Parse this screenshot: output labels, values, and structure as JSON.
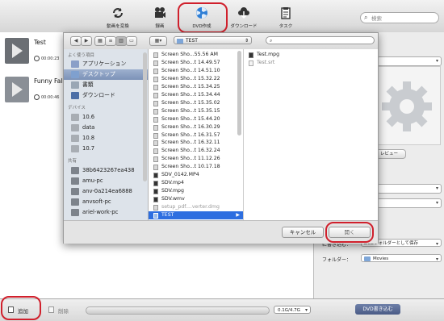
{
  "toolbar": {
    "buttons": [
      {
        "label": "動画を変換",
        "icon": "convert-icon"
      },
      {
        "label": "録画",
        "icon": "record-icon"
      },
      {
        "label": "DVD作成",
        "icon": "dvd-burn-icon"
      },
      {
        "label": "ダウンロード",
        "icon": "download-icon"
      },
      {
        "label": "タスク",
        "icon": "task-icon"
      }
    ],
    "search_placeholder": "検索"
  },
  "videos": [
    {
      "title": "Test",
      "duration": "00:00:23"
    },
    {
      "title": "Funny Fall",
      "duration": "00:00:46"
    }
  ],
  "right_panel": {
    "preview_label": "レビュー",
    "write_label": "に書き込む：",
    "write_value": "DVDフォルダーとして保存",
    "folder_label": "フォルダー：",
    "folder_value": "Movies"
  },
  "bottom": {
    "add_label": "追加",
    "delete_label": "削除",
    "capacity": "0.1G/4.7G",
    "burn_label": "DVD書き込む"
  },
  "dialog": {
    "location": "TEST",
    "search_icon": "search-icon",
    "sidebar": [
      {
        "kind": "head",
        "label": "よく使う項目"
      },
      {
        "kind": "item",
        "label": "アプリケーション",
        "icon": "applications-icon"
      },
      {
        "kind": "item",
        "label": "デスクトップ",
        "icon": "desktop-icon",
        "selected": true
      },
      {
        "kind": "item",
        "label": "書類",
        "icon": "documents-icon"
      },
      {
        "kind": "item",
        "label": "ダウンロード",
        "icon": "downloads-icon"
      },
      {
        "kind": "head",
        "label": "デバイス"
      },
      {
        "kind": "item",
        "label": "10.6",
        "icon": "disk-icon"
      },
      {
        "kind": "item",
        "label": "data",
        "icon": "disk-icon"
      },
      {
        "kind": "item",
        "label": "10.8",
        "icon": "disk-icon"
      },
      {
        "kind": "item",
        "label": "10.7",
        "icon": "disk-icon"
      },
      {
        "kind": "head",
        "label": "共有"
      },
      {
        "kind": "item",
        "label": "38b6423267ea438",
        "icon": "network-computer-icon"
      },
      {
        "kind": "item",
        "label": "amu-pc",
        "icon": "network-computer-icon"
      },
      {
        "kind": "item",
        "label": "anv-0a214ea6888",
        "icon": "network-computer-icon"
      },
      {
        "kind": "item",
        "label": "anvsoft-pc",
        "icon": "network-computer-icon"
      },
      {
        "kind": "item",
        "label": "ariel-work-pc",
        "icon": "network-computer-icon"
      }
    ],
    "files": [
      "Screen Sho...55.56 AM",
      "Screen Sho...t 14.49.57",
      "Screen Sho...t 14.51.10",
      "Screen Sho...t 15.32.22",
      "Screen Sho...t 15.34.25",
      "Screen Sho...t 15.34.44",
      "Screen Sho...t 15.35.02",
      "Screen Sho...t 15.35.15",
      "Screen Sho...t 15.44.20",
      "Screen Sho...t 16.30.29",
      "Screen Sho...t 16.31.57",
      "Screen Sho...t 16.32.11",
      "Screen Sho...t 16.32.24",
      "Screen Sho...t 11.12.26",
      "Screen Sho...t 10.17.18",
      "SDV_0142.MP4",
      "SDV.mp4",
      "SDV.mpg",
      "SDV.wmv",
      "setup_pdf....verter.dmg",
      "TEST"
    ],
    "selected_folder": "TEST",
    "folder_contents": [
      "Test.mpg",
      "Test.srt"
    ],
    "cancel_label": "キャンセル",
    "open_label": "開く"
  },
  "colors": {
    "accent_ring": "#d0202c",
    "selection": "#2d6ee0",
    "burn_button": "#5466a0"
  }
}
